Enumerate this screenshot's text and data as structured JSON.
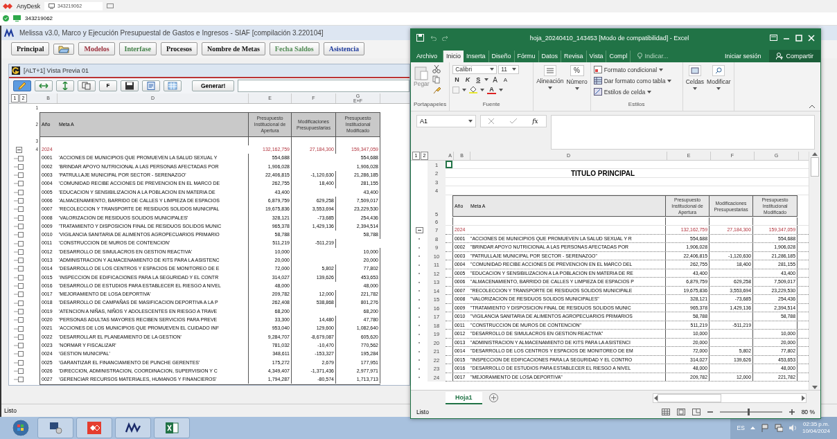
{
  "anydesk": {
    "app_name": "AnyDesk",
    "tab_label": "343219062",
    "address": "343219062"
  },
  "melissa": {
    "title": "Melissa v3.0, Marco y Ejecución Presupuestal de Gastos e Ingresos - SIAF  [compilación 3.220104]",
    "menu": [
      {
        "kind": "text",
        "label": "Principal",
        "color": "#111111"
      },
      {
        "kind": "icon"
      },
      {
        "kind": "text",
        "label": "Modelos",
        "color": "#9b2d3a"
      },
      {
        "kind": "text",
        "label": "Interfase",
        "color": "#3f7f45"
      },
      {
        "kind": "text",
        "label": "Procesos",
        "color": "#111111"
      },
      {
        "kind": "text",
        "label": "Nombre de Metas",
        "color": "#111111"
      },
      {
        "kind": "text",
        "label": "Fecha Saldos",
        "color": "#4e8a52"
      },
      {
        "kind": "text",
        "label": "Asistencia",
        "color": "#1d3a9c"
      }
    ],
    "child_title": "[ALT+1] Vista Previa 01",
    "toolbar": {
      "edit_selected": true,
      "font_button": "F",
      "generate_button": "Generar!"
    },
    "sheet": {
      "outline_levels": [
        "1",
        "2"
      ],
      "columns": [
        "B",
        "D",
        "E",
        "F",
        "G"
      ],
      "column_g_formula": "E+F",
      "row_numbers": [
        "1",
        "2",
        "3",
        "4"
      ],
      "header": {
        "year": "Año",
        "meta": "Meta A",
        "col_e": "Presupuesto Institucional de Apertura",
        "col_f": "Modificaciones Presupuestarias",
        "col_g": "Presupuesto Institucional Modificado"
      },
      "total": {
        "year": "2024",
        "e": "132,162,759",
        "f": "27,184,300",
        "g": "159,347,059",
        "expanded": true
      },
      "rows": [
        {
          "code": "0001",
          "meta": "'ACCIONES DE MUNICIPIOS QUE PROMUEVEN LA SALUD SEXUAL Y",
          "e": "554,688",
          "g": "554,688"
        },
        {
          "code": "0002",
          "meta": "'BRINDAR APOYO NUTRICIONAL A LAS PERSONAS AFECTADAS POR",
          "e": "1,906,028",
          "g": "1,906,028"
        },
        {
          "code": "0003",
          "meta": "'PATRULLAJE MUNICIPAL POR SECTOR - SERENAZGO'",
          "e": "22,406,815",
          "f": "-1,120,630",
          "g": "21,286,185"
        },
        {
          "code": "0004",
          "meta": "'COMUNIDAD RECIBE ACCIONES DE PREVENCION EN EL MARCO DE",
          "e": "262,755",
          "f": "18,400",
          "g": "281,155"
        },
        {
          "code": "0005",
          "meta": "'EDUCACION Y SENSIBILIZACION A LA POBLACION EN MATERIA DE",
          "e": "43,400",
          "g": "43,400"
        },
        {
          "code": "0006",
          "meta": "'ALMACENAMIENTO, BARRIDO DE CALLES Y LIMPIEZA DE ESPACIOS",
          "e": "6,879,759",
          "f": "629,258",
          "g": "7,509,017"
        },
        {
          "code": "0007",
          "meta": "'RECOLECCION Y TRANSPORTE DE RESIDUOS SOLIDOS MUNICIPAL",
          "e": "19,675,836",
          "f": "3,553,694",
          "g": "23,229,530"
        },
        {
          "code": "0008",
          "meta": "'VALORIZACION DE RESIDUOS SOLIDOS MUNICIPALES'",
          "e": "328,121",
          "f": "-73,685",
          "g": "254,436"
        },
        {
          "code": "0009",
          "meta": "'TRATAMIENTO Y DISPOSICION FINAL DE RESIDUOS SOLIDOS MUNIC",
          "e": "965,378",
          "f": "1,429,136",
          "g": "2,394,514"
        },
        {
          "code": "0010",
          "meta": "'VIGILANCIA SANITARIA DE ALIMENTOS AGROPECUARIOS PRIMARIO",
          "e": "58,788",
          "g": "58,788"
        },
        {
          "code": "0011",
          "meta": "'CONSTRUCCION DE MUROS DE CONTENCION'",
          "e": "511,219",
          "f": "-511,219"
        },
        {
          "code": "0012",
          "meta": "'DESARROLLO DE SIMULACROS EN GESTION REACTIVA'",
          "e": "10,000",
          "g": "10,000"
        },
        {
          "code": "0013",
          "meta": "'ADMINISTRACION Y ALMACENAMIENTO DE KITS PARA LA ASISTENC",
          "e": "20,000",
          "g": "20,000"
        },
        {
          "code": "0014",
          "meta": "'DESARROLLO DE LOS CENTROS Y ESPACIOS DE MONITOREO DE E",
          "e": "72,000",
          "f": "5,802",
          "g": "77,802"
        },
        {
          "code": "0015",
          "meta": "'INSPECCION DE EDIFICACIONES PARA LA SEGURIDAD Y EL CONTR",
          "e": "314,027",
          "f": "139,626",
          "g": "453,653"
        },
        {
          "code": "0016",
          "meta": "'DESARROLLO DE ESTUDIOS PARA ESTABLECER EL RIESGO A NIVEL",
          "e": "48,000",
          "g": "48,000"
        },
        {
          "code": "0017",
          "meta": "'MEJORAMIENTO DE LOSA DEPORTIVA'",
          "e": "209,782",
          "f": "12,000",
          "g": "221,782"
        },
        {
          "code": "0018",
          "meta": "'DESARROLLO DE CAMPAÑAS DE MASIFICACION DEPORTIVA A LA P",
          "e": "262,408",
          "f": "538,868",
          "g": "801,276"
        },
        {
          "code": "0019",
          "meta": "'ATENCION A NIÑAS, NIÑOS Y ADOLESCENTES EN RIESGO A TRAVE",
          "e": "68,200",
          "g": "68,200"
        },
        {
          "code": "0020",
          "meta": "'PERSONAS ADULTAS MAYORES RECIBEN SERVICIOS PARA PREVE",
          "e": "33,300",
          "f": "14,480",
          "g": "47,780"
        },
        {
          "code": "0021",
          "meta": "'ACCIONES DE LOS MUNICIPIOS QUE PROMUEVEN EL CUIDADO INF",
          "e": "953,040",
          "f": "129,600",
          "g": "1,082,640"
        },
        {
          "code": "0022",
          "meta": "'DESARROLLAR EL PLANEAMIENTO DE LA GESTION'",
          "e": "9,284,707",
          "f": "-8,679,087",
          "g": "605,620"
        },
        {
          "code": "0023",
          "meta": "'NORMAR Y FISCALIZAR'",
          "e": "781,032",
          "f": "-10,470",
          "g": "770,562"
        },
        {
          "code": "0024",
          "meta": "'GESTION MUNICIPAL'",
          "e": "348,611",
          "f": "-153,327",
          "g": "195,284"
        },
        {
          "code": "0025",
          "meta": "'GARANTIZAR EL FINANCIAMIENTO DE PUNCHE GERENTES'",
          "e": "175,272",
          "f": "2,679",
          "g": "177,951"
        },
        {
          "code": "0026",
          "meta": "'DIRECCION, ADMINISTRACION, COORDINACION, SUPERVISION Y C",
          "e": "4,349,407",
          "f": "-1,371,436",
          "g": "2,977,971"
        },
        {
          "code": "0027",
          "meta": "'GERENCIAR RECURSOS MATERIALES, HUMANOS Y FINANCIEROS'",
          "e": "1,794,287",
          "f": "-80,574",
          "g": "1,713,713"
        }
      ]
    },
    "status": "Listo"
  },
  "excel": {
    "title": "hoja_20240410_143453  [Modo de compatibilidad] - Excel",
    "tabs": [
      {
        "label": "Archivo",
        "selected": false
      },
      {
        "label": "Inicio",
        "selected": true
      },
      {
        "label": "Inserta",
        "selected": false
      },
      {
        "label": "Diseño",
        "selected": false
      },
      {
        "label": "Fórmu",
        "selected": false
      },
      {
        "label": "Datos",
        "selected": false
      },
      {
        "label": "Revisa",
        "selected": false
      },
      {
        "label": "Vista",
        "selected": false
      },
      {
        "label": "Compl",
        "selected": false
      }
    ],
    "tell_me": "Indicar...",
    "sign_in": "Iniciar sesión",
    "share": "Compartir",
    "ribbon": {
      "paste": "Pegar",
      "font_name": "Calibri",
      "font_size": "11",
      "bold": "N",
      "italic": "K",
      "underline": "S",
      "grow_font": "A",
      "shrink_font": "A",
      "font_color": "A",
      "alignment": "Alineación",
      "number_symbol": "%",
      "number": "Número",
      "cond_format": "Formato condicional",
      "format_table": "Dar formato como tabla",
      "cell_styles": "Estilos de celda",
      "cells": "Celdas",
      "editing": "Modificar",
      "groups": [
        "Portapapeles",
        "Fuente",
        "Estilos"
      ]
    },
    "name_box": "A1",
    "function_label": "fx",
    "sheet": {
      "outline_levels": [
        "1",
        "2"
      ],
      "columns": [
        "A",
        "B",
        "D",
        "E",
        "F",
        "G"
      ],
      "title": "TITULO PRINCIPAL",
      "header": {
        "year": "Año",
        "meta": "Meta A",
        "col_e": "Presupuesto Institucional de Apertura",
        "col_f": "Modificaciones Presupuestarias",
        "col_g": "Presupuesto Institucional Modificado"
      },
      "total": {
        "row_number": "7",
        "year": "2024",
        "e": "132,162,759",
        "f": "27,184,300",
        "g": "159,347,059",
        "expanded": true
      },
      "top_row_numbers": [
        "1",
        "2",
        "3",
        "4",
        "5",
        "6"
      ],
      "rows": [
        {
          "row_number": "8",
          "code": "0001",
          "meta": "\"ACCIONES DE MUNICIPIOS QUE PROMUEVEN LA SALUD SEXUAL Y R",
          "e": "554,688",
          "g": "554,688"
        },
        {
          "row_number": "9",
          "code": "0002",
          "meta": "\"BRINDAR APOYO NUTRICIONAL A LAS PERSONAS AFECTADAS POR",
          "e": "1,906,028",
          "g": "1,906,028"
        },
        {
          "row_number": "10",
          "code": "0003",
          "meta": "\"PATRULLAJE MUNICIPAL POR SECTOR - SERENAZGO\"",
          "e": "22,406,815",
          "f": "-1,120,630",
          "g": "21,286,185"
        },
        {
          "row_number": "11",
          "code": "0004",
          "meta": "\"COMUNIDAD RECIBE ACCIONES DE PREVENCION EN EL MARCO DEL",
          "e": "262,755",
          "f": "18,400",
          "g": "281,155"
        },
        {
          "row_number": "12",
          "code": "0005",
          "meta": "\"EDUCACION Y SENSIBILIZACION A LA POBLACION EN MATERIA DE RE",
          "e": "43,400",
          "g": "43,400"
        },
        {
          "row_number": "13",
          "code": "0006",
          "meta": "\"ALMACENAMIENTO, BARRIDO DE CALLES Y LIMPIEZA DE ESPACIOS P",
          "e": "6,879,759",
          "f": "629,258",
          "g": "7,509,017"
        },
        {
          "row_number": "14",
          "code": "0007",
          "meta": "\"RECOLECCION Y TRANSPORTE DE RESIDUOS SOLIDOS MUNICIPALE",
          "e": "19,675,836",
          "f": "3,553,694",
          "g": "23,229,530"
        },
        {
          "row_number": "15",
          "code": "0008",
          "meta": "\"VALORIZACION DE RESIDUOS SOLIDOS MUNICIPALES\"",
          "e": "328,121",
          "f": "-73,685",
          "g": "254,436"
        },
        {
          "row_number": "16",
          "code": "0009",
          "meta": "\"TRATAMIENTO Y DISPOSICION FINAL DE RESIDUOS SOLIDOS MUNIC",
          "e": "965,378",
          "f": "1,429,136",
          "g": "2,394,514"
        },
        {
          "row_number": "17",
          "code": "0010",
          "meta": "\"VIGILANCIA SANITARIA DE ALIMENTOS AGROPECUARIOS PRIMARIOS",
          "e": "58,788",
          "g": "58,788"
        },
        {
          "row_number": "18",
          "code": "0011",
          "meta": "\"CONSTRUCCION DE MUROS DE CONTENCION\"",
          "e": "511,219",
          "f": "-511,219"
        },
        {
          "row_number": "19",
          "code": "0012",
          "meta": "\"DESARROLLO DE SIMULACROS EN GESTION REACTIVA\"",
          "e": "10,000",
          "g": "10,000"
        },
        {
          "row_number": "20",
          "code": "0013",
          "meta": "\"ADMINISTRACION Y ALMACENAMIENTO DE KITS PARA LA ASISTENCI",
          "e": "20,000",
          "g": "20,000"
        },
        {
          "row_number": "21",
          "code": "0014",
          "meta": "\"DESARROLLO DE LOS CENTROS Y ESPACIOS DE MONITOREO DE EM",
          "e": "72,000",
          "f": "5,802",
          "g": "77,802"
        },
        {
          "row_number": "22",
          "code": "0015",
          "meta": "\"INSPECCION DE EDIFICACIONES PARA LA SEGURIDAD Y EL CONTRO",
          "e": "314,027",
          "f": "139,626",
          "g": "453,653"
        },
        {
          "row_number": "23",
          "code": "0016",
          "meta": "\"DESARROLLO DE ESTUDIOS PARA ESTABLECER EL RIESGO A NIVEL",
          "e": "48,000",
          "g": "48,000"
        },
        {
          "row_number": "24",
          "code": "0017",
          "meta": "\"MEJORAMIENTO DE LOSA DEPORTIVA\"",
          "e": "209,782",
          "f": "12,000",
          "g": "221,782"
        }
      ]
    },
    "sheet_tabs": [
      {
        "label": "Hoja1",
        "selected": true
      }
    ],
    "status": "Listo",
    "zoom": "80 %",
    "zoom_slider": {
      "level": 0.45
    }
  },
  "taskbar": {
    "language": "ES",
    "time": "02:35 p.m.",
    "date": "10/04/2024"
  }
}
